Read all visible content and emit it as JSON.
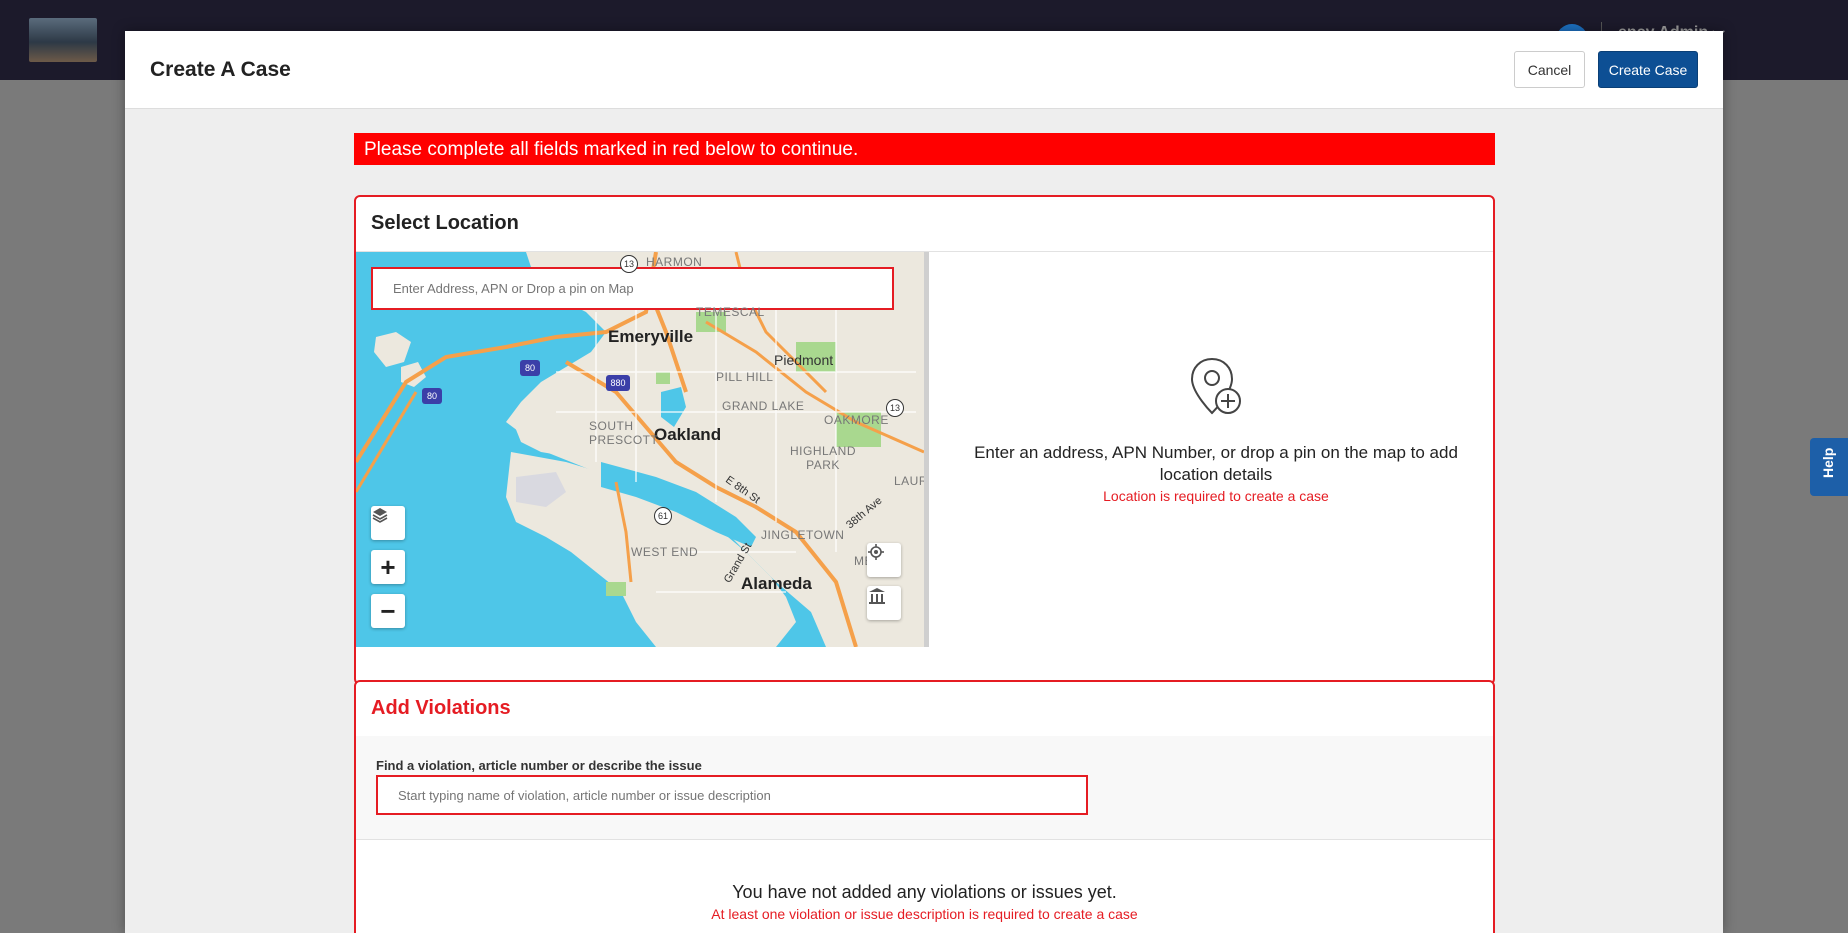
{
  "app": {
    "user_name": "ency Admin"
  },
  "help": {
    "label": "Help"
  },
  "modal": {
    "title": "Create A Case",
    "cancel_label": "Cancel",
    "create_label": "Create Case",
    "error_banner": "Please complete all fields marked in red below to continue."
  },
  "location": {
    "title": "Select Location",
    "search_placeholder": "Enter Address, APN or Drop a pin on Map",
    "empty_message": "Enter an address, APN Number, or drop a pin on the map to add location details",
    "required_message": "Location is required to create a case",
    "map_labels": {
      "emeryville": "Emeryville",
      "piedmont": "Piedmont",
      "oakland": "Oakland",
      "alameda": "Alameda",
      "temescal": "TEMESCAL",
      "harmon": "HARMON",
      "pill_hill": "PILL HILL",
      "grand_lake": "GRAND LAKE",
      "oakmore": "OAKMORE",
      "south_prescott": "SOUTH\nPRESCOTT",
      "highland_park": "HIGHLAND\nPARK",
      "jingletown": "JINGLETOWN",
      "west_end": "WEST END",
      "e8th": "E 8th St",
      "grand_st": "Grand St",
      "ave38": "38th Ave",
      "laure": "LAURE",
      "me": "ME",
      "shield_80a": "80",
      "shield_80b": "80",
      "shield_880": "880",
      "shield_13a": "13",
      "shield_13b": "13",
      "shield_61": "61"
    }
  },
  "violations": {
    "title": "Add Violations",
    "search_label": "Find a violation, article number or describe the issue",
    "search_placeholder": "Start typing name of violation, article number or issue description",
    "empty_message": "You have not added any violations or issues yet.",
    "required_message": "At least one violation or issue description is required to create a case"
  },
  "colors": {
    "primary": "#0d4f94",
    "error": "#e51c23",
    "water": "#4ec6e8",
    "land": "#ece8de",
    "roads": "#f5a04a"
  }
}
